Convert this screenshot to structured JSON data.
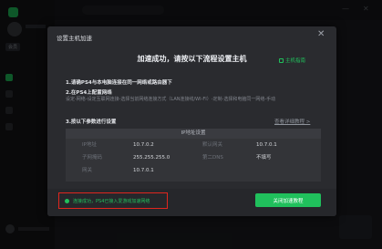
{
  "background": {
    "vip_badge": "会员"
  },
  "dialog": {
    "title": "设置主机加速",
    "headline": "加速成功，请按以下流程设置主机",
    "top_link": "主机指南",
    "step1": "1.请确PS4与本电脑连接在同一网络或路由器下",
    "step2": "2.在PS4上配置网络",
    "step2_desc": "设定-网络-设定互联网连接-选择当前网络连接方式（LAN连接线/WI-FI）-定制-选择和电脑同一网络-手动",
    "step3": "3.按以下参数进行设置",
    "step3_link": "查看详细教程 >",
    "table_header": "IP地址设置",
    "rows": [
      {
        "label1": "IP地址",
        "value1": "10.7.0.2",
        "label2": "默认网关",
        "value2": "10.7.0.1"
      },
      {
        "label1": "子网掩码",
        "value1": "255.255.255.0",
        "label2": "第二DNS",
        "value2": "不填写"
      },
      {
        "label1": "网关",
        "value1": "10.7.0.1",
        "label2": "",
        "value2": ""
      }
    ],
    "status_text": "连接成功，PS4已接入爱游戏加速网络",
    "done_button": "关闭加速教程"
  },
  "colors": {
    "accent": "#20c05c",
    "highlight_border": "#e0261e"
  }
}
